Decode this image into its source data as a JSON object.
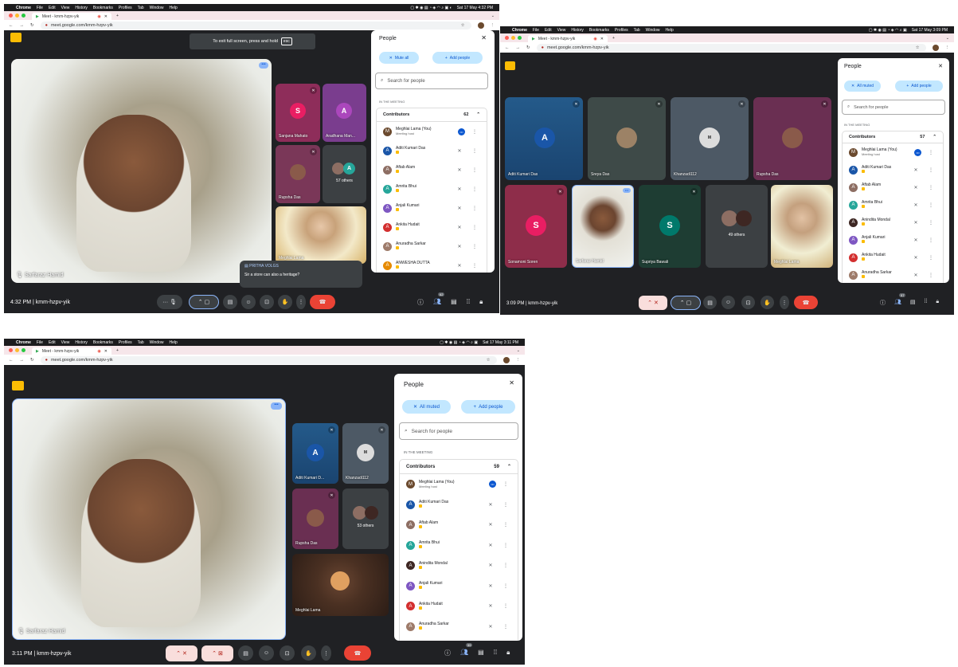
{
  "meeting_code": "kmm-hzpv-yik",
  "browser": {
    "app_name": "Chrome",
    "menu": [
      "File",
      "Edit",
      "View",
      "History",
      "Bookmarks",
      "Profiles",
      "Tab",
      "Window",
      "Help"
    ],
    "tab_title": "Meet - kmm-hzpv-yik",
    "url": "meet.google.com/kmm-hzpv-yik"
  },
  "colors": {
    "accent": "#0b57d0",
    "chip": "#c2e7ff",
    "end_call": "#ea4335",
    "tab_bg": "#f6e6ea",
    "meet_bg": "#202124"
  },
  "people_panel": {
    "title": "People",
    "add_people": "Add people",
    "search_placeholder": "Search for people",
    "section": "IN THE MEETING",
    "contributors_label": "Contributors",
    "host_label": "Meeting host"
  },
  "shot1": {
    "clock": "Sat 17 May 4:32 PM",
    "time": "4:32 PM",
    "fullscreen_tip": "To exit full screen, press and hold",
    "esc_key": "esc",
    "mute_label": "Mute all",
    "contributors_count": "62",
    "participants_badge": "62",
    "speaker_name": "Sarfaraz Hamid",
    "tiles": [
      {
        "name": "Sanjana Mahato",
        "initial": "S"
      },
      {
        "name": "Aradhana Man...",
        "initial": "A"
      },
      {
        "name": "Rupsha Das"
      },
      {
        "name": "57 others"
      },
      {
        "name": "Meghlai Lama"
      }
    ],
    "chat": {
      "sender": "PRITHA VOLGS",
      "message": "Sir a store can also a heritage?"
    },
    "rows": [
      {
        "name": "Meghlai Lama (You)",
        "host": true,
        "initial": "M",
        "color": "#6b4a2e"
      },
      {
        "name": "Aditi Kumari Das",
        "initial": "A",
        "color": "#1a56a8"
      },
      {
        "name": "Aftab Alam",
        "initial": "A",
        "color": "#8d6e63"
      },
      {
        "name": "Amrita Bhui",
        "initial": "A",
        "color": "#26a69a"
      },
      {
        "name": "Anjali Kumari",
        "initial": "A",
        "color": "#7e57c2"
      },
      {
        "name": "Ankita Hudait",
        "initial": "A",
        "color": "#d32f2f"
      },
      {
        "name": "Anuradha Sarkar",
        "initial": "A",
        "color": "#9e7b6a"
      },
      {
        "name": "ANWESHA DUTTA",
        "initial": "A",
        "color": "#e68a00"
      }
    ]
  },
  "shot2": {
    "clock": "Sat 17 May 3:09 PM",
    "time": "3:09 PM",
    "mute_label": "All muted",
    "contributors_count": "57",
    "participants_badge": "57",
    "tiles": [
      {
        "name": "Aditi Kumari Das",
        "initial": "A"
      },
      {
        "name": "Sreya Das"
      },
      {
        "name": "Khanzadi112"
      },
      {
        "name": "Rupsha Das"
      },
      {
        "name": "Sonamoni Soren",
        "initial": "S"
      },
      {
        "name": "Sarfaraz Hamid"
      },
      {
        "name": "Supriya Bawali",
        "initial": "S"
      },
      {
        "name": "49 others"
      },
      {
        "name": "Meghlai Lama"
      }
    ],
    "rows": [
      {
        "name": "Meghlai Lama (You)",
        "host": true,
        "initial": "M",
        "color": "#6b4a2e"
      },
      {
        "name": "Aditi Kumari Das",
        "initial": "A",
        "color": "#1a56a8"
      },
      {
        "name": "Aftab Alam",
        "initial": "A",
        "color": "#8d6e63"
      },
      {
        "name": "Amrita Bhui",
        "initial": "A",
        "color": "#26a69a"
      },
      {
        "name": "Anindita Mondal",
        "initial": "A",
        "color": "#3e2723"
      },
      {
        "name": "Anjali Kumari",
        "initial": "A",
        "color": "#7e57c2"
      },
      {
        "name": "Ankita Hudait",
        "initial": "A",
        "color": "#d32f2f"
      },
      {
        "name": "Anuradha Sarkar",
        "initial": "A",
        "color": "#9e7b6a"
      }
    ]
  },
  "shot3": {
    "clock": "Sat 17 May 3:11 PM",
    "time": "3:11 PM",
    "mute_label": "All muted",
    "contributors_count": "59",
    "participants_badge": "59",
    "speaker_name": "Sarfaraz Hamid",
    "tiles": [
      {
        "name": "Aditi Kumari D...",
        "initial": "A"
      },
      {
        "name": "Khanzadi112"
      },
      {
        "name": "Rupsha Das"
      },
      {
        "name": "53 others"
      },
      {
        "name": "Meghlai Lama"
      }
    ],
    "rows": [
      {
        "name": "Meghlai Lama (You)",
        "host": true,
        "initial": "M",
        "color": "#6b4a2e"
      },
      {
        "name": "Aditi Kumari Das",
        "initial": "A",
        "color": "#1a56a8"
      },
      {
        "name": "Aftab Alam",
        "initial": "A",
        "color": "#8d6e63"
      },
      {
        "name": "Amrita Bhui",
        "initial": "A",
        "color": "#26a69a"
      },
      {
        "name": "Anindita Mondal",
        "initial": "A",
        "color": "#3e2723"
      },
      {
        "name": "Anjali Kumari",
        "initial": "A",
        "color": "#7e57c2"
      },
      {
        "name": "Ankita Hudait",
        "initial": "A",
        "color": "#d32f2f"
      },
      {
        "name": "Anuradha Sarkar",
        "initial": "A",
        "color": "#9e7b6a"
      }
    ]
  }
}
